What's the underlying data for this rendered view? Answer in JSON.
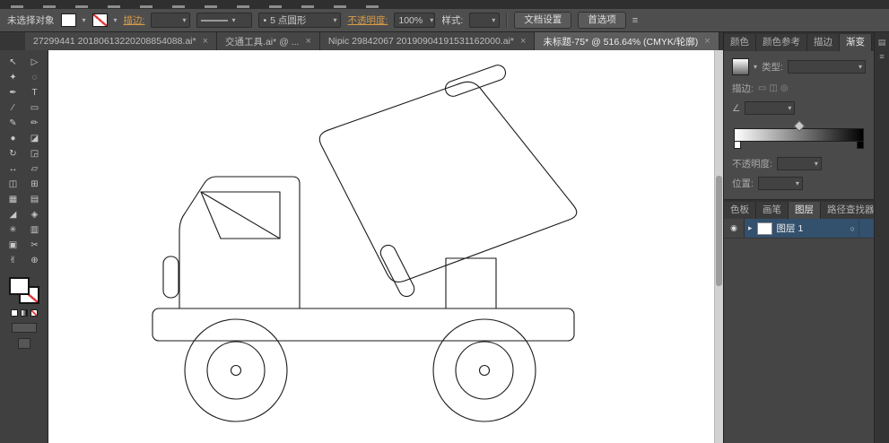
{
  "control_bar": {
    "selection_status": "未选择对象",
    "stroke_label": "描边:",
    "brush_definition": "5 点圆形",
    "opacity_label": "不透明度:",
    "opacity_value": "100%",
    "style_label": "样式:",
    "document_setup_button": "文档设置",
    "preferences_button": "首选项"
  },
  "document_tabs": [
    {
      "label": "27299441 20180613220208854088.ai*",
      "active": false
    },
    {
      "label": "交通工具.ai* @ ...",
      "active": false
    },
    {
      "label": "Nipic 29842067 20190904191531162000.ai*",
      "active": false
    },
    {
      "label": "未标题-75* @ 516.64% (CMYK/轮廓)",
      "active": true
    }
  ],
  "toolbar": {
    "tools": [
      {
        "name": "selection",
        "glyph": "↖"
      },
      {
        "name": "direct-selection",
        "glyph": "▷"
      },
      {
        "name": "magic-wand",
        "glyph": "✦"
      },
      {
        "name": "lasso",
        "glyph": "◌"
      },
      {
        "name": "pen",
        "glyph": "✒"
      },
      {
        "name": "type",
        "glyph": "T"
      },
      {
        "name": "line-segment",
        "glyph": "∕"
      },
      {
        "name": "rectangle",
        "glyph": "▭"
      },
      {
        "name": "paintbrush",
        "glyph": "✎"
      },
      {
        "name": "pencil",
        "glyph": "✏"
      },
      {
        "name": "blob-brush",
        "glyph": "●"
      },
      {
        "name": "eraser",
        "glyph": "◪"
      },
      {
        "name": "rotate",
        "glyph": "↻"
      },
      {
        "name": "scale",
        "glyph": "◲"
      },
      {
        "name": "width",
        "glyph": "↔"
      },
      {
        "name": "free-transform",
        "glyph": "▱"
      },
      {
        "name": "shape-builder",
        "glyph": "◫"
      },
      {
        "name": "perspective-grid",
        "glyph": "⊞"
      },
      {
        "name": "mesh",
        "glyph": "▦"
      },
      {
        "name": "gradient",
        "glyph": "▤"
      },
      {
        "name": "eyedropper",
        "glyph": "◢"
      },
      {
        "name": "blend",
        "glyph": "◈"
      },
      {
        "name": "symbol-sprayer",
        "glyph": "✳"
      },
      {
        "name": "column-graph",
        "glyph": "▥"
      },
      {
        "name": "artboard",
        "glyph": "▣"
      },
      {
        "name": "slice",
        "glyph": "✂"
      },
      {
        "name": "hand",
        "glyph": "✌"
      },
      {
        "name": "zoom",
        "glyph": "⊕"
      }
    ]
  },
  "canvas": {
    "artwork": "cement mixer truck outline drawing"
  },
  "right_panel": {
    "top_tabs": [
      {
        "label": "颜色",
        "active": false
      },
      {
        "label": "颜色参考",
        "active": false
      },
      {
        "label": "描边",
        "active": false
      },
      {
        "label": "渐变",
        "active": true
      }
    ],
    "gradient_panel": {
      "type_label": "类型:",
      "stroke_label": "描边:",
      "opacity_label": "不透明度:",
      "position_label": "位置:"
    },
    "bottom_tabs": [
      {
        "label": "色板",
        "active": false
      },
      {
        "label": "画笔",
        "active": false
      },
      {
        "label": "图层",
        "active": true
      },
      {
        "label": "路径查找器",
        "active": false
      }
    ],
    "layers": [
      {
        "name": "图层 1"
      }
    ]
  },
  "icons": {
    "close": "×",
    "caret": "▾",
    "panel_menu": "≡",
    "rail_top": "▤",
    "rail_bottom": "≡",
    "eye": "◉",
    "target": "○",
    "disclosure": "▸",
    "angle": "∠",
    "bullet": "•",
    "stroke_icons": "▭◫◎",
    "control_bar_right": "≡"
  },
  "colors": {
    "gradient_start": "#ffffff",
    "gradient_end": "#000000",
    "layer_selection": "#33506d",
    "link_text": "#d79b4a",
    "none_indicator": "#e0393c"
  }
}
